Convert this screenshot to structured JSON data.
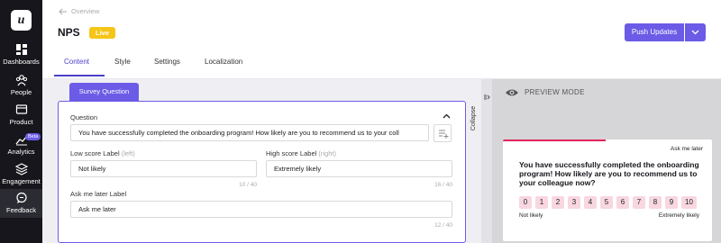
{
  "sidebar": {
    "logo": "u",
    "items": [
      {
        "label": "Dashboards",
        "icon": "grid-icon"
      },
      {
        "label": "People",
        "icon": "people-icon"
      },
      {
        "label": "Product",
        "icon": "product-icon"
      },
      {
        "label": "Analytics",
        "icon": "analytics-icon",
        "badge": "Beta"
      },
      {
        "label": "Engagement",
        "icon": "layers-icon"
      },
      {
        "label": "Feedback",
        "icon": "chat-icon",
        "active": true
      }
    ]
  },
  "header": {
    "back_label": "Overview",
    "title": "NPS",
    "status_badge": "Live",
    "push_button": "Push Updates",
    "tabs": [
      {
        "label": "Content",
        "active": true
      },
      {
        "label": "Style"
      },
      {
        "label": "Settings"
      },
      {
        "label": "Localization"
      }
    ]
  },
  "editor": {
    "section_tab": "Survey Question",
    "question_label": "Question",
    "question_value": "You have successfully completed the onboarding program! How likely are you to recommend us to your coll",
    "low_label": "Low score Label",
    "low_hint": "(left)",
    "low_value": "Not likely",
    "low_count": "10 / 40",
    "high_label": "High score Label",
    "high_hint": "(right)",
    "high_value": "Extremely likely",
    "high_count": "16 / 40",
    "ask_label": "Ask me later Label",
    "ask_value": "Ask me later",
    "ask_count": "12 / 40"
  },
  "splitter": {
    "label": "Collapse"
  },
  "preview": {
    "mode_label": "PREVIEW MODE",
    "progress": 0.49,
    "ask_later": "Ask me later",
    "question": "You have successfully completed the onboarding program! How likely are you to recommend us to your colleague now?",
    "scores": [
      "0",
      "1",
      "2",
      "3",
      "4",
      "5",
      "6",
      "7",
      "8",
      "9",
      "10"
    ],
    "low": "Not likely",
    "high": "Extremely likely"
  },
  "colors": {
    "accent": "#6b5be6",
    "live": "#f5c518",
    "nps_pink": "#f8d7e0",
    "progress": "#e0245e",
    "sidebar": "#16161c"
  }
}
